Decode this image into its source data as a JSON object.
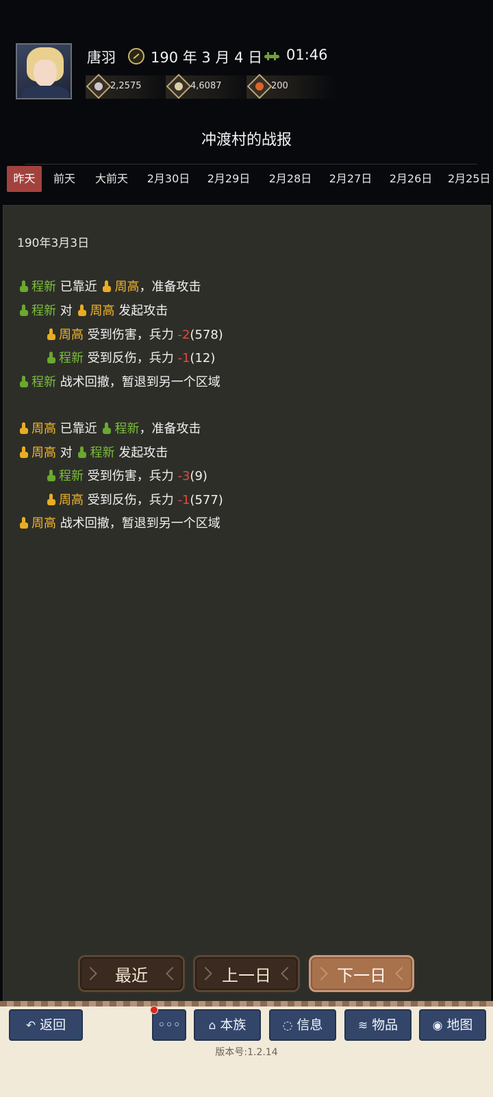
{
  "header": {
    "player_name": "唐羽",
    "date": "190 年 3 月 4 日",
    "time": "01:46",
    "resources": [
      {
        "icon": "silver-coin-icon",
        "value": "2,2575"
      },
      {
        "icon": "grain-icon",
        "value": "4,6087"
      },
      {
        "icon": "food-icon",
        "value": "200"
      }
    ]
  },
  "page_title": "冲渡村的战报",
  "tabs": [
    "昨天",
    "前天",
    "大前天",
    "2月30日",
    "2月29日",
    "2月28日",
    "2月27日",
    "2月26日",
    "2月25日"
  ],
  "active_tab": "昨天",
  "report": {
    "date": "190年3月3日",
    "lines": [
      {
        "a": "程新",
        "t1": "已靠近",
        "b": "周高",
        "t2": "，准备攻击"
      },
      {
        "a": "程新",
        "t1": "对",
        "b": "周高",
        "t2": "发起攻击"
      },
      {
        "unit": "周高",
        "text": "受到伤害，兵力",
        "delta": "-2",
        "remain": "(578)"
      },
      {
        "unit": "程新",
        "text": "受到反伤，兵力",
        "delta": "-1",
        "remain": "(12)"
      },
      {
        "a": "程新",
        "t1": "战术回撤，暂退到另一个区域"
      },
      {
        "a": "周高",
        "t1": "已靠近",
        "b": "程新",
        "t2": "，准备攻击"
      },
      {
        "a": "周高",
        "t1": "对",
        "b": "程新",
        "t2": "发起攻击"
      },
      {
        "unit": "程新",
        "text": "受到伤害，兵力",
        "delta": "-3",
        "remain": "(9)"
      },
      {
        "unit": "周高",
        "text": "受到反伤，兵力",
        "delta": "-1",
        "remain": "(577)"
      },
      {
        "a": "周高",
        "t1": "战术回撤，暂退到另一个区域"
      }
    ]
  },
  "nav": {
    "recent": "最近",
    "prev_day": "上一日",
    "next_day": "下一日"
  },
  "bottom_bar": {
    "back": "返回",
    "more": "◦◦◦",
    "clan": "本族",
    "info": "信息",
    "items": "物品",
    "map": "地图",
    "version": "版本号:1.2.14"
  },
  "colors": {
    "green_unit": "#7bbf3a",
    "yellow_unit": "#f0b42a",
    "negative": "#e04a3a",
    "active_tab": "#a3423d"
  }
}
